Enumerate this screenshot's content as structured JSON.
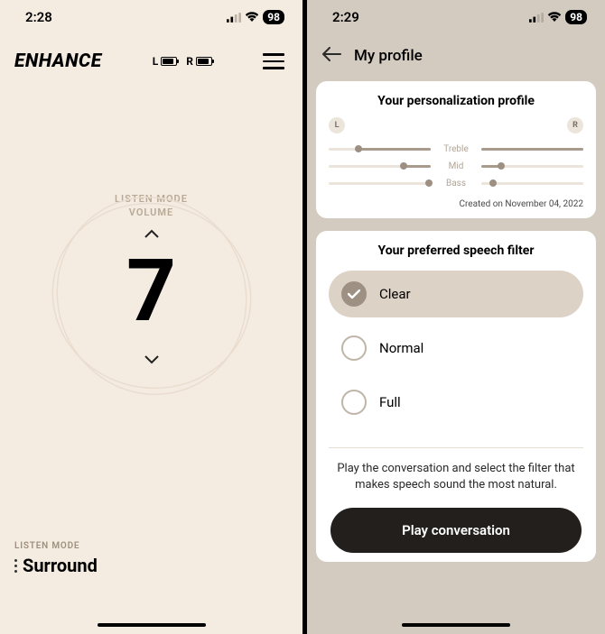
{
  "left": {
    "status": {
      "time": "2:28",
      "battery": "98"
    },
    "brand": "ENHANCE",
    "battery": {
      "left_label": "L",
      "right_label": "R"
    },
    "volume": {
      "label_line1": "LISTEN MODE",
      "label_line2": "VOLUME",
      "value": "7"
    },
    "listen_mode": {
      "label": "LISTEN MODE",
      "value": "Surround"
    }
  },
  "right": {
    "status": {
      "time": "2:29",
      "battery": "98"
    },
    "header": {
      "title": "My profile"
    },
    "profile_card": {
      "title": "Your personalization profile",
      "left_pill": "L",
      "right_pill": "R",
      "rows": {
        "treble": "Treble",
        "mid": "Mid",
        "bass": "Bass"
      },
      "created": "Created on November 04, 2022"
    },
    "filter_card": {
      "title": "Your preferred speech filter",
      "options": {
        "clear": "Clear",
        "normal": "Normal",
        "full": "Full"
      },
      "selected": "clear",
      "help": "Play the conversation and select the filter that makes speech sound the most natural.",
      "button": "Play conversation"
    }
  }
}
